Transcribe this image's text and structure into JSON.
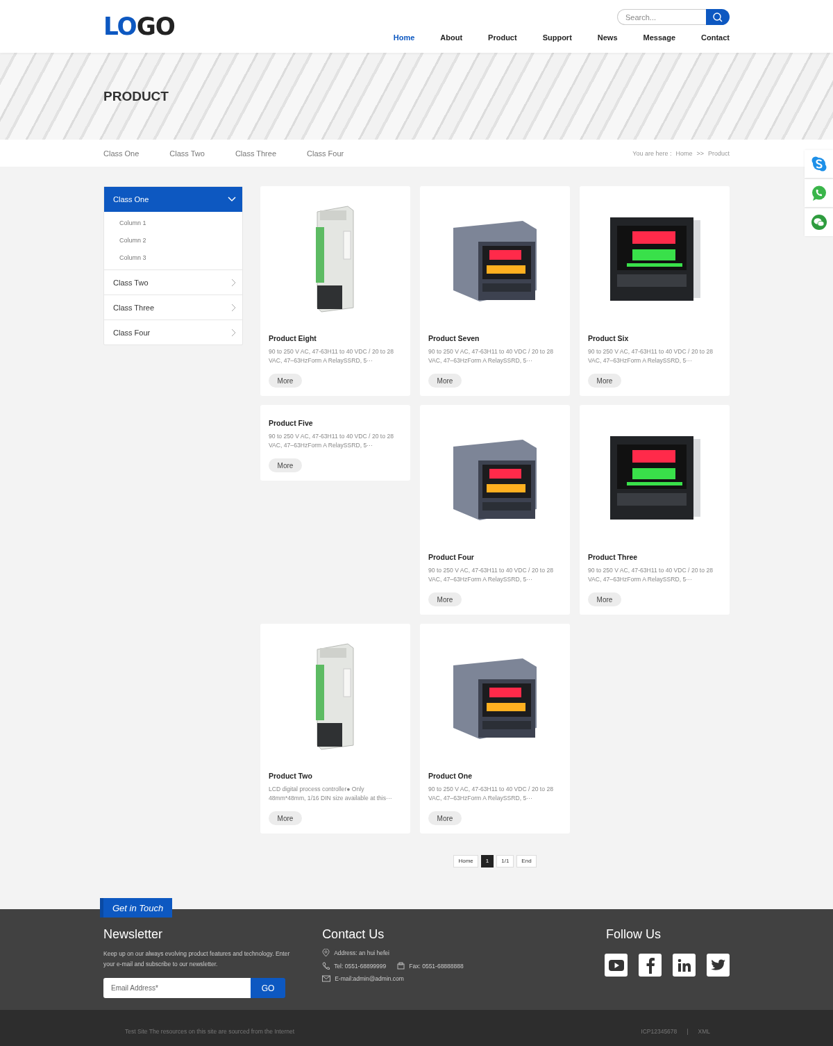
{
  "header": {
    "logo": {
      "part1": "LO",
      "part2": "GO"
    },
    "search": {
      "placeholder": "Search..."
    },
    "nav": [
      {
        "label": "Home",
        "selected": true
      },
      {
        "label": "About",
        "selected": false
      },
      {
        "label": "Product",
        "selected": false
      },
      {
        "label": "Support",
        "selected": false
      },
      {
        "label": "News",
        "selected": false
      },
      {
        "label": "Message",
        "selected": false
      },
      {
        "label": "Contact",
        "selected": false
      }
    ]
  },
  "banner": {
    "title": "PRODUCT"
  },
  "subnav": {
    "classes": [
      "Class One",
      "Class Two",
      "Class Three",
      "Class Four"
    ],
    "breadcrumb": {
      "prefix": "You are here :",
      "items": [
        "Home",
        "Product"
      ],
      "separator": ">>"
    }
  },
  "side_contacts": [
    {
      "kind": "skype"
    },
    {
      "kind": "whatsapp"
    },
    {
      "kind": "wechat"
    }
  ],
  "sidebar": {
    "items": [
      {
        "label": "Class One",
        "expanded": true,
        "children": [
          {
            "label": "Column 1"
          },
          {
            "label": "Column 2"
          },
          {
            "label": "Column 3"
          }
        ]
      },
      {
        "label": "Class Two",
        "expanded": false
      },
      {
        "label": "Class Three",
        "expanded": false
      },
      {
        "label": "Class Four",
        "expanded": false
      }
    ]
  },
  "products": [
    {
      "name": "Product Eight",
      "kind": "din-rail",
      "description": "90 to 250 V AC, 47-63H11 to 40 VDC / 20 to 28 VAC, 47–63HzForm A RelaySSRD, 5···",
      "button": "More"
    },
    {
      "name": "Product Seven",
      "kind": "small-controller",
      "description": "90 to 250 V AC, 47-63H11 to 40 VDC / 20 to 28 VAC, 47–63HzForm A RelaySSRD, 5···",
      "button": "More"
    },
    {
      "name": "Product Six",
      "kind": "large-controller",
      "description": "90 to 250 V AC, 47-63H11 to 40 VDC / 20 to 28 VAC, 47–63HzForm A RelaySSRD, 5···",
      "button": "More"
    },
    {
      "name": "Product Five",
      "kind": "text-only",
      "description": "90 to 250 V AC, 47-63H11 to 40 VDC / 20 to 28 VAC, 47–63HzForm A RelaySSRD, 5···",
      "button": "More"
    },
    {
      "name": "Product Four",
      "kind": "small-controller",
      "description": "90 to 250 V AC, 47-63H11 to 40 VDC / 20 to 28 VAC, 47–63HzForm A RelaySSRD, 5···",
      "button": "More"
    },
    {
      "name": "Product Three",
      "kind": "large-controller",
      "description": "90 to 250 V AC, 47-63H11 to 40 VDC / 20 to 28 VAC, 47–63HzForm A RelaySSRD, 5···",
      "button": "More"
    },
    {
      "name": "Product Two",
      "kind": "din-rail",
      "description": "LCD digital process controller● Only 48mm*48mm, 1/16 DIN size available at this···",
      "button": "More"
    },
    {
      "name": "Product One",
      "kind": "small-controller",
      "description": "90 to 250 V AC, 47-63H11 to 40 VDC / 20 to 28 VAC, 47–63HzForm A RelaySSRD, 5···",
      "button": "More"
    }
  ],
  "pagination": [
    {
      "label": "Home",
      "selected": false
    },
    {
      "label": "1",
      "selected": true
    },
    {
      "label": "1/1",
      "selected": false
    },
    {
      "label": "End",
      "selected": false
    }
  ],
  "footer": {
    "tab": "Get in Touch",
    "newsletter": {
      "title": "Newsletter",
      "text": "Keep up on our always evolving product features and technology. Enter your e-mail and subscribe to our newsletter.",
      "placeholder": "Email Address*",
      "button": "GO"
    },
    "contact": {
      "title": "Contact Us",
      "lines": [
        {
          "kind": "address",
          "text": "Address: an hui hefei"
        },
        {
          "kind": "phone",
          "text": "Tel: 0551-68899999"
        },
        {
          "kind": "fax",
          "text": "Fax: 0551-68888888"
        },
        {
          "kind": "email",
          "text": "E-mail:admin@admin.com"
        }
      ]
    },
    "follow": {
      "title": "Follow Us",
      "links": [
        {
          "kind": "youtube"
        },
        {
          "kind": "facebook"
        },
        {
          "kind": "linkedin"
        },
        {
          "kind": "twitter"
        }
      ]
    },
    "bottom": {
      "copyright": "Test Site The resources on this site are sourced from the Internet",
      "icp": "ICP12345678",
      "separator": "|",
      "xml": "XML"
    }
  }
}
